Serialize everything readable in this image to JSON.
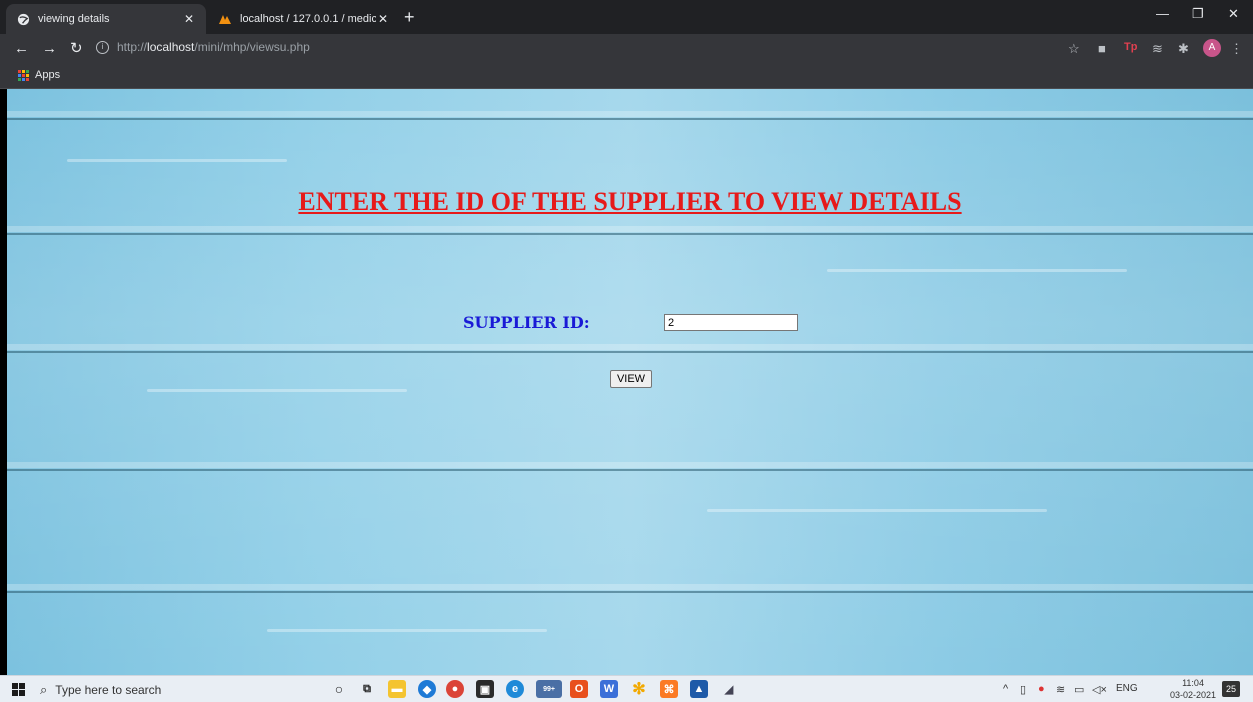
{
  "browser": {
    "tabs": [
      {
        "title": "viewing details",
        "active": true
      },
      {
        "title": "localhost / 127.0.0.1 / medical /",
        "active": false
      }
    ],
    "new_tab": "+",
    "url_prefix": "http://",
    "url_host": "localhost",
    "url_path": "/mini/mhp/viewsu.php",
    "bookmarks_apps": "Apps",
    "profile_initial": "A"
  },
  "page": {
    "heading": "ENTER THE ID OF THE SUPPLIER TO VIEW DETAILS",
    "supplier_label": "SUPPLIER ID:",
    "supplier_value": "2",
    "view_button": "VIEW",
    "colors": {
      "heading": "#e61a1a",
      "label": "#1a1ad6",
      "background": "#93d0e8"
    }
  },
  "taskbar": {
    "search_placeholder": "Type here to search",
    "badge_count": "99+",
    "language": "ENG",
    "time": "11:04",
    "date": "03-02-2021",
    "notifications": "25"
  }
}
